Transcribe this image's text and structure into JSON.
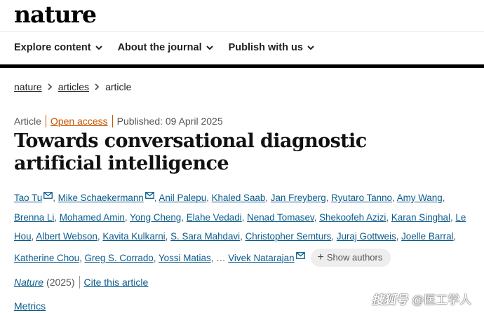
{
  "header": {
    "logo": "nature",
    "nav": [
      {
        "label": "Explore content"
      },
      {
        "label": "About the journal"
      },
      {
        "label": "Publish with us"
      }
    ]
  },
  "breadcrumb": {
    "items": [
      "nature",
      "articles",
      "article"
    ]
  },
  "article": {
    "type": "Article",
    "access": "Open access",
    "published": "Published: 09 April 2025",
    "title": "Towards conversational diagnostic artificial intelligence",
    "authors": [
      {
        "name": "Tao Tu",
        "email": true
      },
      {
        "name": "Mike Schaekermann",
        "email": true
      },
      {
        "name": "Anil Palepu"
      },
      {
        "name": "Khaled Saab"
      },
      {
        "name": "Jan Freyberg"
      },
      {
        "name": "Ryutaro Tanno"
      },
      {
        "name": "Amy Wang"
      },
      {
        "name": "Brenna Li"
      },
      {
        "name": "Mohamed Amin"
      },
      {
        "name": "Yong Cheng"
      },
      {
        "name": "Elahe Vedadi"
      },
      {
        "name": "Nenad Tomasev"
      },
      {
        "name": "Shekoofeh Azizi"
      },
      {
        "name": "Karan Singhal"
      },
      {
        "name": "Le Hou"
      },
      {
        "name": "Albert Webson"
      },
      {
        "name": "Kavita Kulkarni"
      },
      {
        "name": "S. Sara Mahdavi"
      },
      {
        "name": "Christopher Semturs"
      },
      {
        "name": "Juraj Gottweis"
      },
      {
        "name": "Joelle Barral"
      },
      {
        "name": "Katherine Chou"
      },
      {
        "name": "Greg S. Corrado"
      },
      {
        "name": "Yossi Matias"
      },
      {
        "name": "Vivek Natarajan",
        "email": true
      }
    ],
    "ellipsis": "…",
    "show_authors": "Show authors",
    "journal": "Nature",
    "year": "(2025)",
    "cite": "Cite this article",
    "metrics": "Metrics"
  },
  "watermark": {
    "logo_text": "搜狐号",
    "handle": "@医工学人"
  }
}
